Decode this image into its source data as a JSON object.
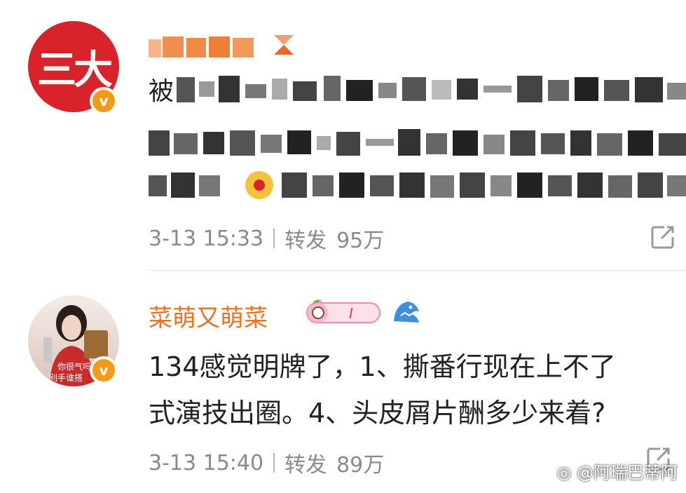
{
  "post1": {
    "avatar_text": "三大",
    "username": " ",
    "timestamp": "3-13 15:33",
    "repost_label": "转发",
    "repost_count": "95万"
  },
  "post2": {
    "username": "菜萌又萌菜",
    "content_line1": "134感觉明牌了，1、撕番行现在上不了",
    "content_line2": "式演技出圈。4、头皮屑片酬多少来着?",
    "timestamp": "3-13 15:40",
    "repost_label": "转发",
    "repost_count": "89万",
    "avatar_caption_1": "你很气吗",
    "avatar_caption_2": "别手谁搭"
  },
  "watermark": "@阿瑞巴蒂阿",
  "colors": {
    "username": "#eb7220",
    "verified": "#f39b18",
    "brand_red": "#d8232a",
    "meta_gray": "#8a8a8a"
  },
  "icons": {
    "verified": "v-badge-icon",
    "share": "share-icon",
    "badge": "level-badge-icon",
    "shark": "shark-icon",
    "weibo": "weibo-logo-icon"
  }
}
